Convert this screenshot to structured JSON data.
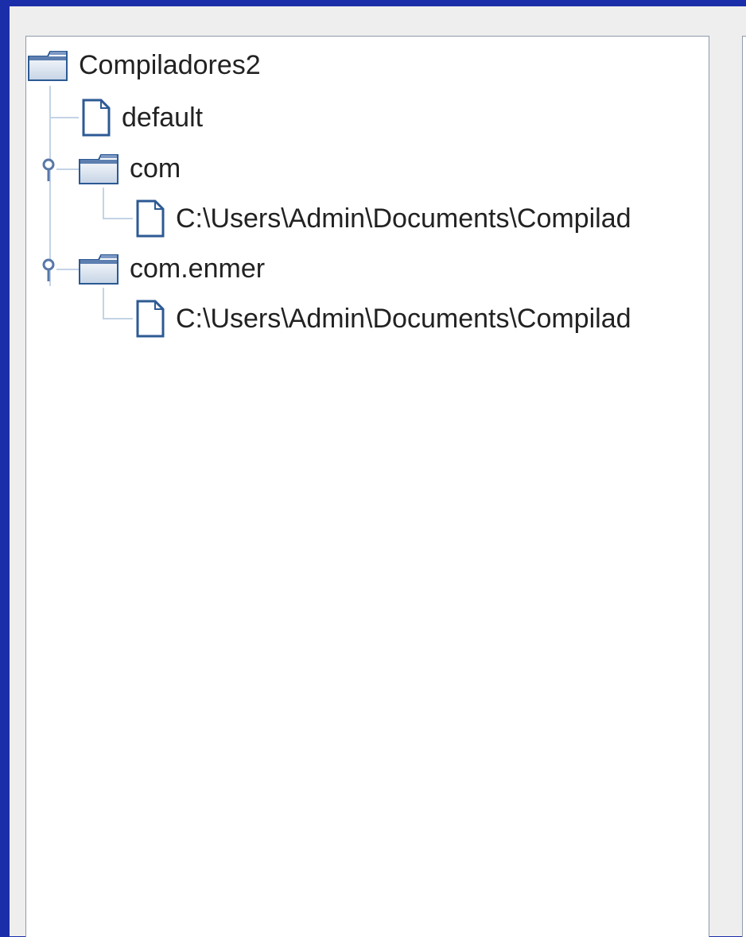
{
  "tree": {
    "root": {
      "label": "Compiladores2",
      "icon": "folder-icon"
    },
    "default_package": {
      "label": "default",
      "icon": "file-icon"
    },
    "package_com": {
      "label": "com",
      "icon": "folder-icon",
      "expanded": true,
      "child": {
        "label": "C:\\Users\\Admin\\Documents\\Compilad",
        "icon": "file-icon"
      }
    },
    "package_com_enmer": {
      "label": "com.enmer",
      "icon": "folder-icon",
      "expanded": true,
      "child": {
        "label": "C:\\Users\\Admin\\Documents\\Compilad",
        "icon": "file-icon"
      }
    }
  },
  "colors": {
    "window_frame": "#1b2ea9",
    "panel_background": "#eeeeee",
    "tree_background": "#ffffff",
    "tree_line": "#c4d3e6",
    "icon_stroke": "#2c5a94",
    "toggle": "#5877a8"
  }
}
